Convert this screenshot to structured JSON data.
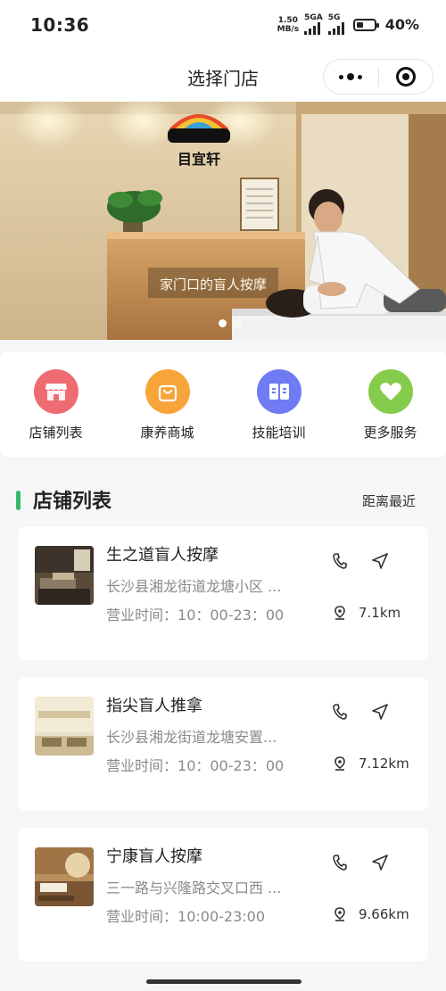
{
  "status_bar": {
    "time": "10:36",
    "net_speed_value": "1.50",
    "net_speed_unit": "MB/s",
    "signal1_label": "5GA",
    "signal2_label": "5G",
    "battery_percent": "40%",
    "battery_level": 0.4
  },
  "nav": {
    "title": "选择门店",
    "more_icon": "more-dots-icon",
    "close_icon": "target-circle-icon"
  },
  "banner": {
    "logo_text": "目宜轩",
    "sign_text": "家门口的盲人按摩",
    "slides_count": 2,
    "active_slide": 0
  },
  "menu": {
    "items": [
      {
        "label": "店铺列表",
        "icon": "store-icon",
        "color": "#ef6b72"
      },
      {
        "label": "康养商城",
        "icon": "shopping-bag-icon",
        "color": "#f7a53a"
      },
      {
        "label": "技能培训",
        "icon": "book-icon",
        "color": "#6f7bf2"
      },
      {
        "label": "更多服务",
        "icon": "heart-icon",
        "color": "#86cc4c"
      }
    ]
  },
  "section": {
    "title": "店铺列表",
    "sort_label": "距离最近",
    "accent": "#35b86c"
  },
  "stores": [
    {
      "name": "生之道盲人按摩",
      "address": "长沙县湘龙街道龙塘小区 ...",
      "hours_label": "营业时间：",
      "hours": "10：00-23：00",
      "distance": "7.1km"
    },
    {
      "name": "指尖盲人推拿",
      "address": "长沙县湘龙街道龙塘安置...",
      "hours_label": "营业时间：",
      "hours": "10：00-23：00",
      "distance": "7.12km"
    },
    {
      "name": "宁康盲人按摩",
      "address": "三一路与兴隆路交叉口西 ...",
      "hours_label": "营业时间：",
      "hours": "10:00-23:00",
      "distance": "9.66km"
    }
  ]
}
